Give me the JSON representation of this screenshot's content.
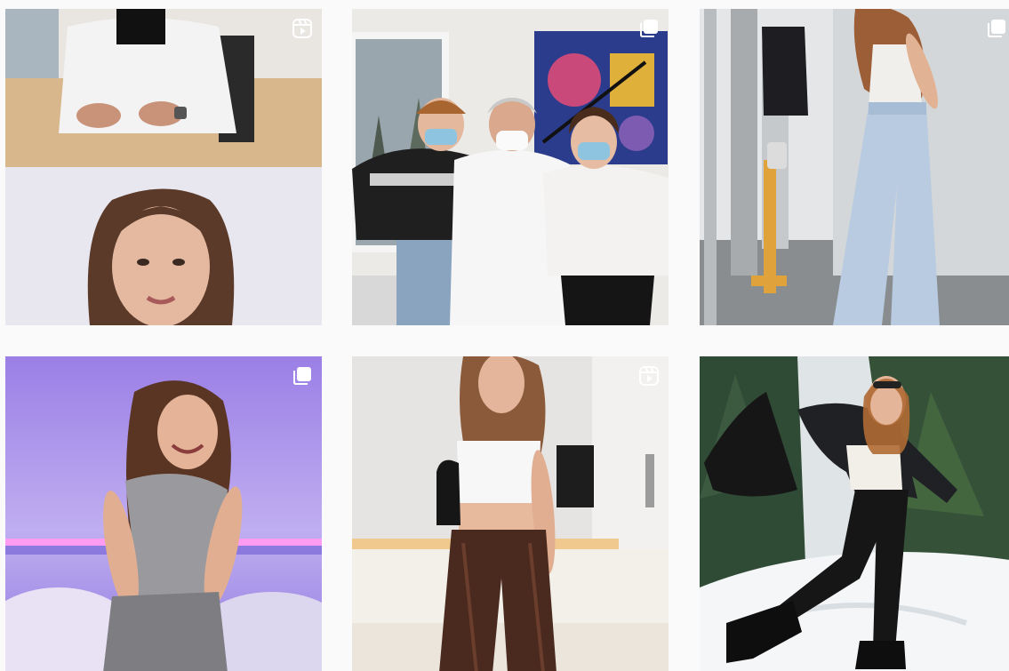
{
  "grid": {
    "posts": [
      {
        "id": "post-1",
        "scene": "doctor-and-selfie-video",
        "badge": "reels-icon"
      },
      {
        "id": "post-2",
        "scene": "group-photo-with-masks",
        "badge": "carousel-icon"
      },
      {
        "id": "post-3",
        "scene": "jeans-outfit-hallway",
        "badge": "carousel-icon"
      },
      {
        "id": "post-4",
        "scene": "purple-led-bedroom-pose",
        "badge": "carousel-icon"
      },
      {
        "id": "post-5",
        "scene": "leather-pants-outfit-bedroom",
        "badge": "reels-icon"
      },
      {
        "id": "post-6",
        "scene": "snow-winter-jump",
        "badge": "none"
      }
    ]
  },
  "colors": {
    "background": "#fafafa",
    "badge": "#ffffff"
  }
}
